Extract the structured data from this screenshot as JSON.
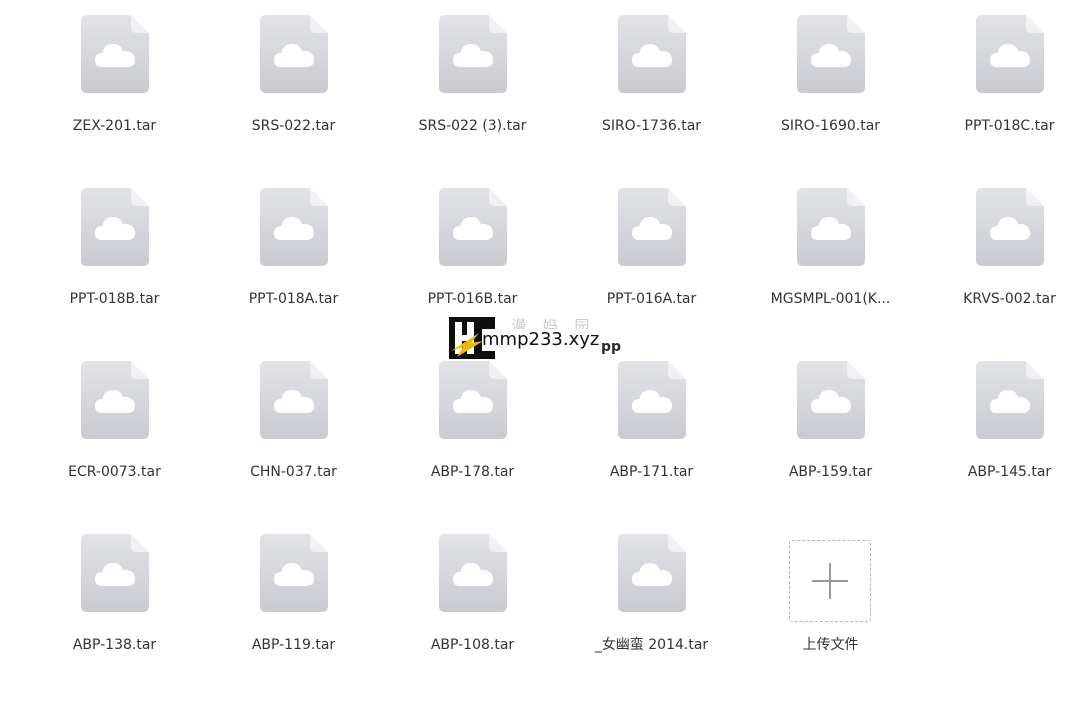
{
  "files": [
    {
      "name": "ZEX-201.tar",
      "icon": "cloud-file-icon"
    },
    {
      "name": "SRS-022.tar",
      "icon": "cloud-file-icon"
    },
    {
      "name": "SRS-022 (3).tar",
      "icon": "cloud-file-icon"
    },
    {
      "name": "SIRO-1736.tar",
      "icon": "cloud-file-icon"
    },
    {
      "name": "SIRO-1690.tar",
      "icon": "cloud-file-icon"
    },
    {
      "name": "PPT-018C.tar",
      "icon": "cloud-file-icon"
    },
    {
      "name": "PPT-018B.tar",
      "icon": "cloud-file-icon"
    },
    {
      "name": "PPT-018A.tar",
      "icon": "cloud-file-icon"
    },
    {
      "name": "PPT-016B.tar",
      "icon": "cloud-file-icon"
    },
    {
      "name": "PPT-016A.tar",
      "icon": "cloud-file-icon"
    },
    {
      "name": "MGSMPL-001(K...",
      "icon": "cloud-file-icon"
    },
    {
      "name": "KRVS-002.tar",
      "icon": "cloud-file-icon"
    },
    {
      "name": "ECR-0073.tar",
      "icon": "cloud-file-icon"
    },
    {
      "name": "CHN-037.tar",
      "icon": "cloud-file-icon"
    },
    {
      "name": "ABP-178.tar",
      "icon": "cloud-file-icon"
    },
    {
      "name": "ABP-171.tar",
      "icon": "cloud-file-icon"
    },
    {
      "name": "ABP-159.tar",
      "icon": "cloud-file-icon"
    },
    {
      "name": "ABP-145.tar",
      "icon": "cloud-file-icon"
    },
    {
      "name": "ABP-138.tar",
      "icon": "cloud-file-icon"
    },
    {
      "name": "ABP-119.tar",
      "icon": "cloud-file-icon"
    },
    {
      "name": "ABP-108.tar",
      "icon": "cloud-file-icon"
    },
    {
      "name": "_女幽蛮  2014.tar",
      "icon": "cloud-file-icon"
    }
  ],
  "upload": {
    "label": "上传文件",
    "icon": "plus-icon"
  },
  "watermark": {
    "text": "mmp233.xyz",
    "faint_text": "漫 妈 园",
    "tail_text": "pp",
    "logo_icon": "watermark-logo-icon"
  },
  "colors": {
    "icon_fill_top": "#e2e3e7",
    "icon_fill_bottom": "#c9cbd1",
    "cloud": "#ffffff",
    "text": "#333333"
  }
}
